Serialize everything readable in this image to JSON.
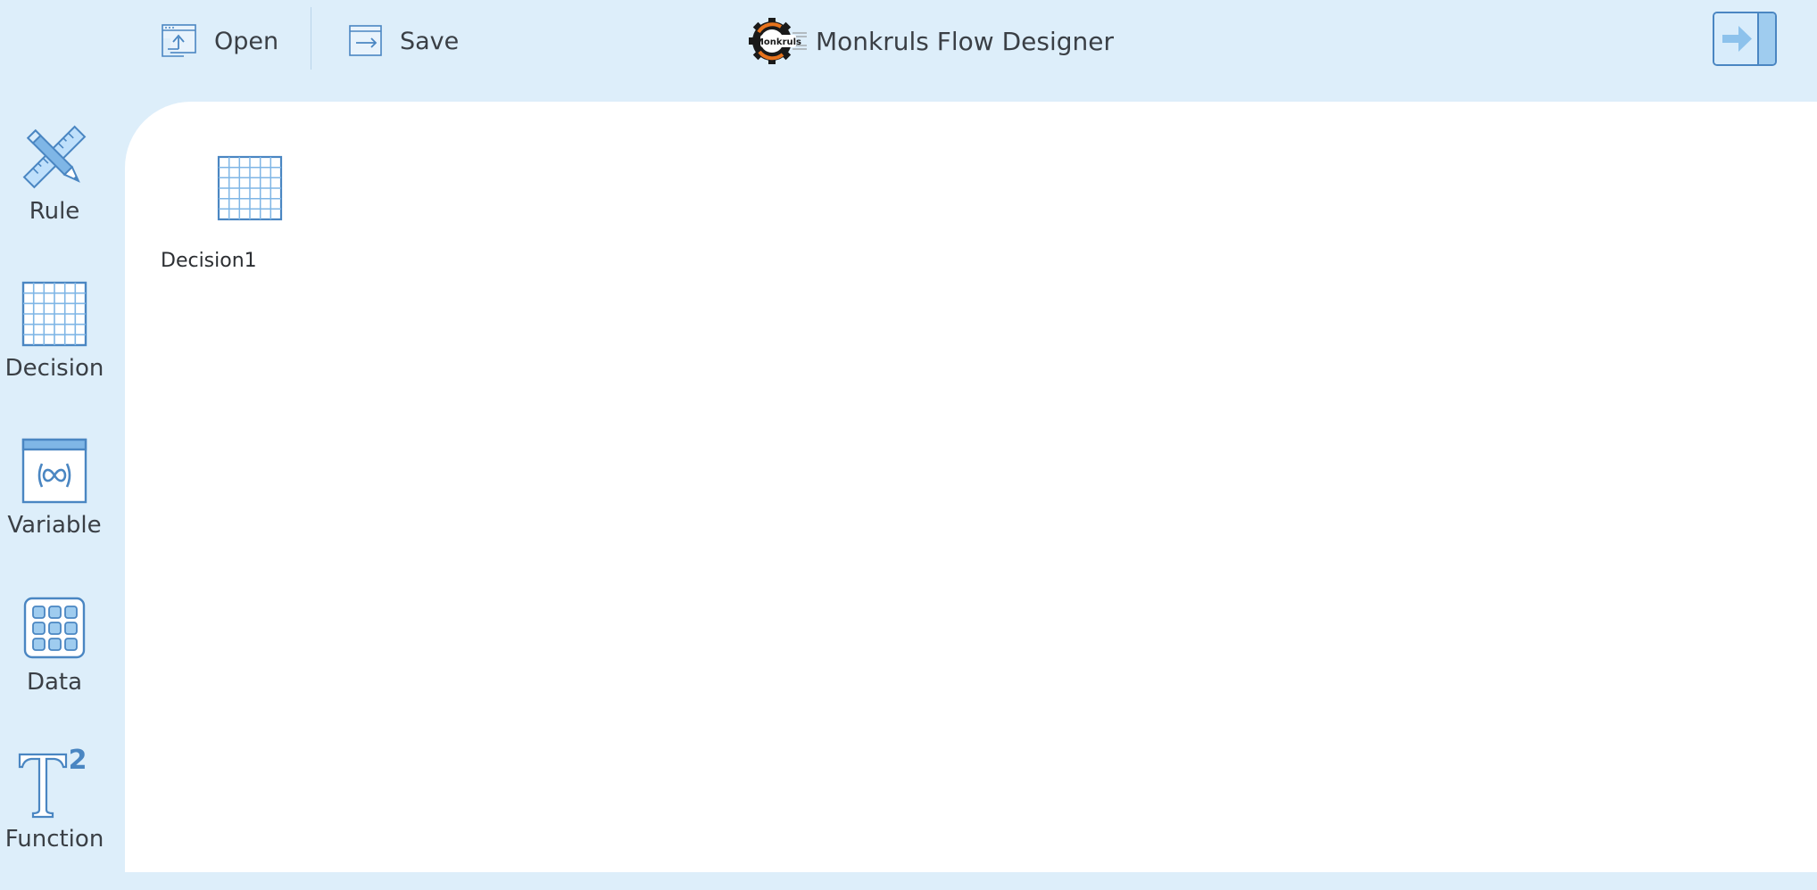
{
  "toolbar": {
    "open_label": "Open",
    "save_label": "Save",
    "app_title": "Monkruls Flow Designer",
    "logo_text": "Monkruls",
    "exit_icon": "exit-arrow-icon"
  },
  "sidebar": {
    "items": [
      {
        "label": "Rule",
        "icon": "ruler-pencil-icon"
      },
      {
        "label": "Decision",
        "icon": "grid-table-icon"
      },
      {
        "label": "Variable",
        "icon": "variable-window-icon"
      },
      {
        "label": "Data",
        "icon": "data-dots-icon"
      },
      {
        "label": "Function",
        "icon": "function-t-squared-icon"
      }
    ]
  },
  "canvas": {
    "nodes": [
      {
        "label": "Decision1",
        "icon": "grid-table-icon"
      }
    ]
  },
  "colors": {
    "background": "#ddeefa",
    "accent": "#4a86c2",
    "canvas": "#ffffff",
    "text": "#3a3f45",
    "logo_orange": "#e8731c"
  }
}
